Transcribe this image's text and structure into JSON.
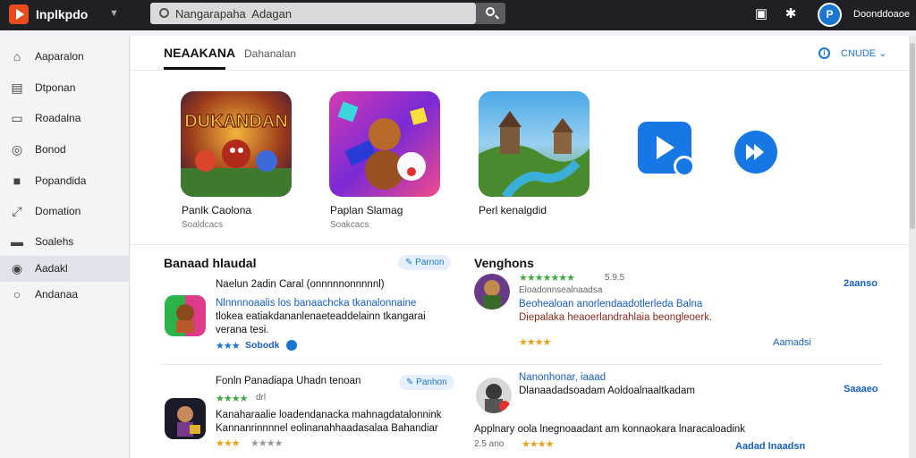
{
  "header": {
    "app_title": "Inplkpdo",
    "search_value": "Nangarapaha  Adagan",
    "user_name": "Doonddoaoe",
    "avatar_letter": "P"
  },
  "sidebar": {
    "items": [
      {
        "label": "Aaparalon",
        "icon": "home-icon"
      },
      {
        "label": "Dtponan",
        "icon": "library-icon"
      },
      {
        "label": "Roadalna",
        "icon": "downloads-icon"
      },
      {
        "label": "Bonod",
        "icon": "gift-icon"
      },
      {
        "label": "Popandida",
        "icon": "bookmark-icon"
      },
      {
        "label": "Domation",
        "icon": "trending-icon"
      },
      {
        "label": "Soalehs",
        "icon": "folder-icon"
      },
      {
        "label": "Aadakl",
        "icon": "eye-icon"
      },
      {
        "label": "Andanaa",
        "icon": "circle-icon"
      }
    ],
    "active_index": 7
  },
  "main": {
    "tab_primary": "NEAAKANA",
    "tab_secondary": "Dahanalan",
    "more_link": "CNUDE ⌄",
    "featured": [
      {
        "name": "Panlk  Caolona",
        "sub": "Soaldcacs"
      },
      {
        "name": "Paplan  Slamag",
        "sub": "Soakcacs"
      },
      {
        "name": "Perl  kenalgdid",
        "sub": ""
      }
    ],
    "left_section": {
      "title": "Banaad  hlaudal",
      "chip": "Parnon",
      "items": [
        {
          "line1": "Naelun  2adin  Caral  (onnnnnonnnnnl)",
          "line2": "Nlnnnnoaalis  los  banaachcka  tkanalonnaine",
          "line3": "tlokea  eatiakdananlenaeteaddelainn  tkangarai",
          "line4": "verana  tesi.",
          "stars": "★★★",
          "rating_label": "Sobodk"
        },
        {
          "line1": "Fonln  Panadiapa  Uhadn  tenoan",
          "chip": "Panhon",
          "stars": "★★★★",
          "rating_label": "drl",
          "line2": "Kanaharaalie  loadendanacka  mahnagdatalonnink",
          "line3": "Kannanrinnnnel  eolinanahhaadasalaa  Bahandiar",
          "stars2": "★★★",
          "rating_label2": "★★★★"
        }
      ]
    },
    "right_section": {
      "title": "Venghons",
      "items": [
        {
          "stars": "★★★★★★★",
          "rating_num": "5.9.5",
          "line1": "Eloadonnsealnaadsa",
          "line2": "Beohealoan  anorlendaadotlerleda  Balna",
          "line3": "Diepalaka  heaoerlandrahlaia  beongleoerk.",
          "stars2": "★★★★",
          "action": "Aamadsi",
          "right_link": "2aanso"
        },
        {
          "line1": "Nanonhonar,  iaaad",
          "line2": "Dlanaadadsoadam  Aoldoalnaaltkadam",
          "line3": "Applnary  oola  lnegnoaadant  am  konnaokara  lnaracaloadink",
          "stars": "★★★★",
          "rating_num": "2.5 ano",
          "action": "Aadad  Inaadsn",
          "right_link": "Saaaeo"
        }
      ]
    }
  }
}
